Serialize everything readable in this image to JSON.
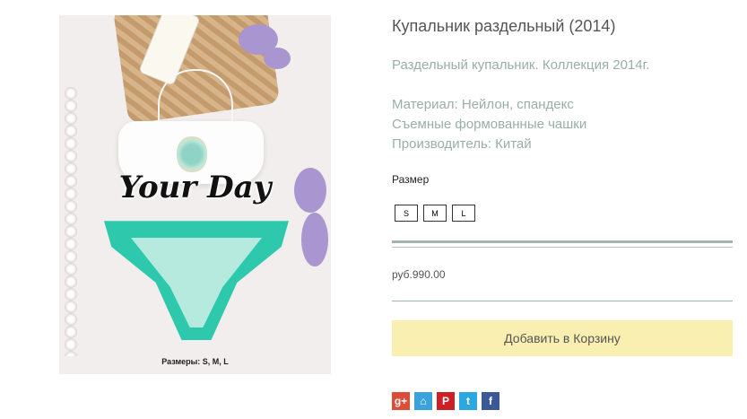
{
  "product": {
    "image_alt": "Купальник раздельный",
    "image_brand_text": "Your Day",
    "image_sizes_caption": "Размеры: S, M, L",
    "title": "Купальник раздельный (2014)",
    "description": "Раздельный купальник. Коллекция 2014г.",
    "details": [
      "Материал: Нейлон, спандекс",
      "Съемные формованные чашки",
      "Производитель: Китай"
    ],
    "size_label": "Размер",
    "sizes": [
      "S",
      "M",
      "L"
    ],
    "price": "руб.990.00",
    "add_to_cart": "Добавить в Корзину"
  },
  "share": [
    {
      "name": "google-plus",
      "glyph": "g+",
      "color": "#dd4b39"
    },
    {
      "name": "odnoklassniki",
      "glyph": "⌂",
      "color": "#3ba3dc"
    },
    {
      "name": "pinterest",
      "glyph": "P",
      "color": "#cb2027"
    },
    {
      "name": "twitter",
      "glyph": "t",
      "color": "#2ca7e0"
    },
    {
      "name": "facebook",
      "glyph": "f",
      "color": "#3b5998"
    }
  ]
}
